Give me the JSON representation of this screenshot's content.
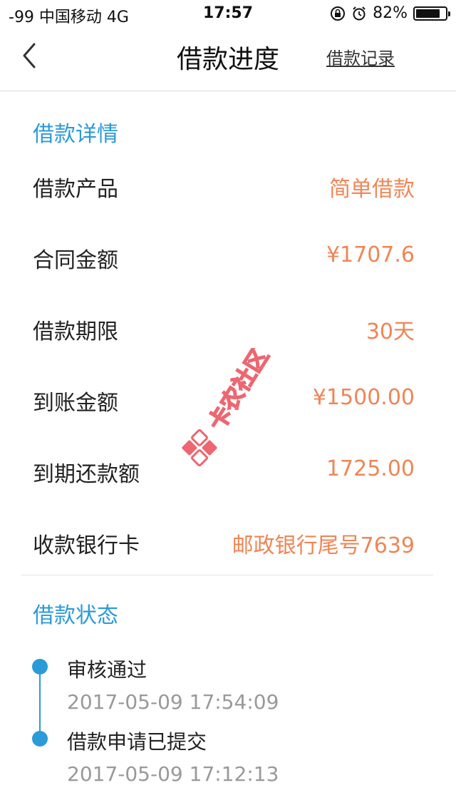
{
  "status_bar": {
    "carrier": "-99 中国移动   4G",
    "time": "17:57",
    "battery_percent": "82%",
    "battery_level": 0.82
  },
  "nav": {
    "title": "借款进度",
    "record_link": "借款记录"
  },
  "details": {
    "section_title": "借款详情",
    "rows": [
      {
        "label": "借款产品",
        "value": "简单借款"
      },
      {
        "label": "合同金额",
        "value": "¥1707.6"
      },
      {
        "label": "借款期限",
        "value": "30天"
      },
      {
        "label": "到账金额",
        "value": "¥1500.00"
      },
      {
        "label": "到期还款额",
        "value": "1725.00"
      },
      {
        "label": "收款银行卡",
        "value": "邮政银行尾号7639"
      }
    ]
  },
  "status": {
    "section_title": "借款状态",
    "steps": [
      {
        "title": "审核通过",
        "time": "2017-05-09 17:54:09"
      },
      {
        "title": "借款申请已提交",
        "time": "2017-05-09 17:12:13"
      }
    ]
  },
  "watermark": {
    "text": "卡农社区"
  },
  "colors": {
    "accent": "#2b9ad8",
    "value": "#f08556",
    "watermark": "#e8424e"
  }
}
